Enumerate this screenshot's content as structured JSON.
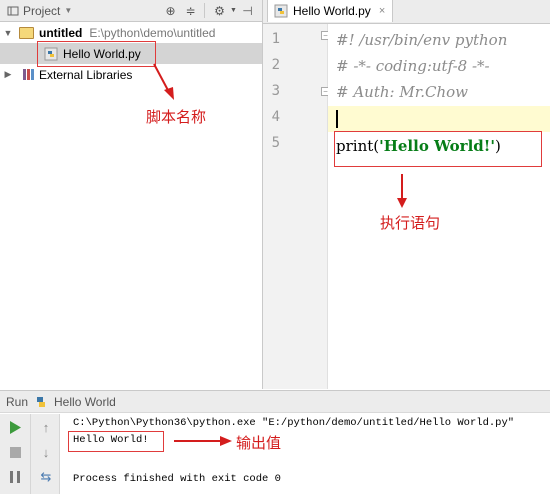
{
  "project_panel": {
    "tab_label": "Project",
    "tree": {
      "root_name": "untitled",
      "root_path": "E:\\python\\demo\\untitled",
      "file_name": "Hello World.py",
      "libraries_label": "External Libraries"
    }
  },
  "editor": {
    "tab_label": "Hello World.py",
    "line_numbers": [
      "1",
      "2",
      "3",
      "4",
      "5"
    ],
    "lines": [
      "#! /usr/bin/env python",
      "# -*- coding:utf-8 -*-",
      "# Auth: Mr.Chow",
      "",
      "print('Hello World!')"
    ],
    "print_fn": "print(",
    "print_str": "'Hello World!'",
    "print_close": ")"
  },
  "annotations": {
    "script_name": "脚本名称",
    "exec_statement": "执行语句",
    "output_value": "输出值",
    "color": "#d41d1d"
  },
  "run_panel": {
    "header_label": "Run",
    "config_name": "Hello World",
    "console_lines": [
      "C:\\Python\\Python36\\python.exe \"E:/python/demo/untitled/Hello World.py\"",
      "Hello World!",
      "",
      "Process finished with exit code 0"
    ]
  },
  "colors": {
    "accent_run": "#3c9a3c",
    "annotation_red": "#e03b3b"
  }
}
